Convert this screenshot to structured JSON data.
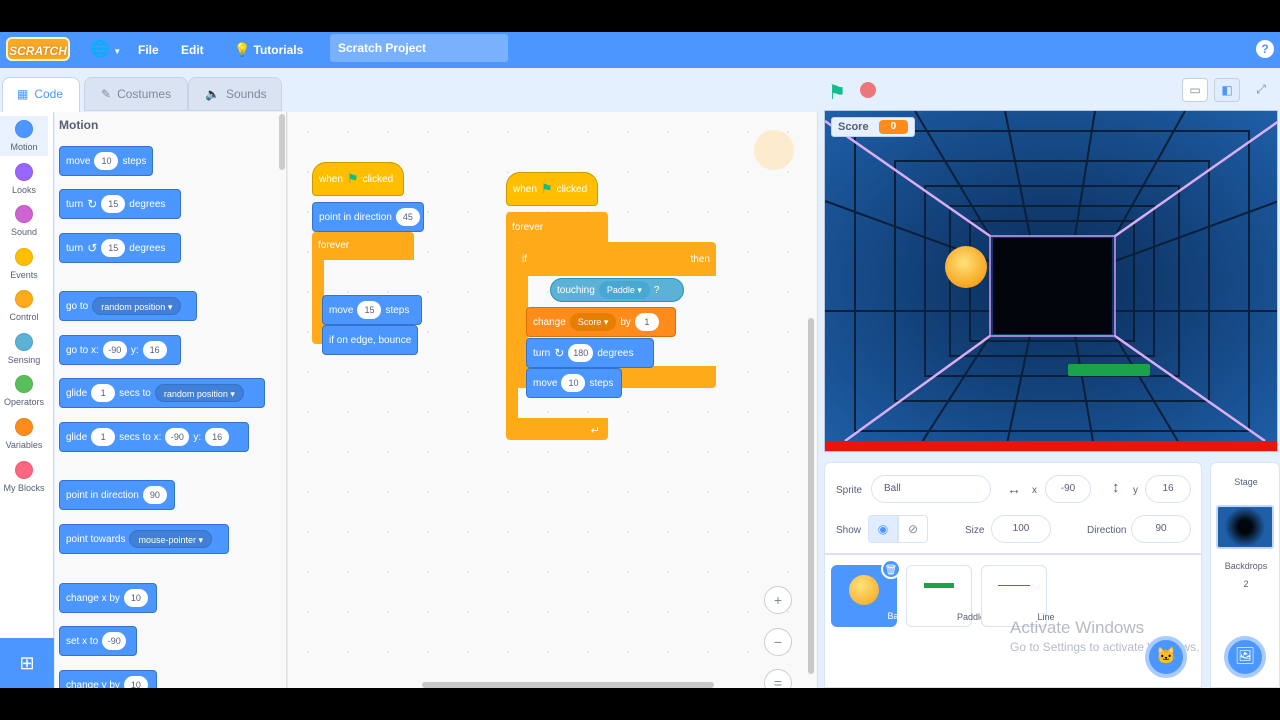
{
  "menubar": {
    "logo": "SCRATCH",
    "file": "File",
    "edit": "Edit",
    "tutorials": "Tutorials",
    "project_title": "Scratch Project",
    "help": "?"
  },
  "tabs": {
    "code": "Code",
    "costumes": "Costumes",
    "sounds": "Sounds"
  },
  "categories": [
    {
      "label": "Motion",
      "color": "#4c97ff"
    },
    {
      "label": "Looks",
      "color": "#9966ff"
    },
    {
      "label": "Sound",
      "color": "#cf63cf"
    },
    {
      "label": "Events",
      "color": "#ffbf00"
    },
    {
      "label": "Control",
      "color": "#ffab19"
    },
    {
      "label": "Sensing",
      "color": "#5cb1d6"
    },
    {
      "label": "Operators",
      "color": "#59c059"
    },
    {
      "label": "Variables",
      "color": "#ff8c1a"
    },
    {
      "label": "My Blocks",
      "color": "#ff6680"
    }
  ],
  "palette": {
    "title": "Motion",
    "move": {
      "a": "move",
      "n": "10",
      "b": "steps"
    },
    "turn_cw": {
      "a": "turn",
      "n": "15",
      "b": "degrees"
    },
    "turn_ccw": {
      "a": "turn",
      "n": "15",
      "b": "degrees"
    },
    "goto": {
      "a": "go to",
      "d": "random position"
    },
    "goto_xy": {
      "a": "go to x:",
      "x": "-90",
      "yl": "y:",
      "y": "16"
    },
    "glide": {
      "a": "glide",
      "n": "1",
      "b": "secs to",
      "d": "random position"
    },
    "glide_xy": {
      "a": "glide",
      "n": "1",
      "b": "secs to x:",
      "x": "-90",
      "yl": "y:",
      "y": "16"
    },
    "point_dir": {
      "a": "point in direction",
      "n": "90"
    },
    "point_towards": {
      "a": "point towards",
      "d": "mouse-pointer"
    },
    "change_x": {
      "a": "change x by",
      "n": "10"
    },
    "set_x": {
      "a": "set x to",
      "n": "-90"
    },
    "change_y": {
      "a": "change y by",
      "n": "10"
    }
  },
  "script1": {
    "hat": {
      "a": "when",
      "b": "clicked"
    },
    "point": {
      "a": "point in direction",
      "n": "45"
    },
    "forever": "forever",
    "move": {
      "a": "move",
      "n": "15",
      "b": "steps"
    },
    "bounce": "if on edge, bounce"
  },
  "script2": {
    "hat": {
      "a": "when",
      "b": "clicked"
    },
    "forever": "forever",
    "if": "if",
    "touching": {
      "a": "touching",
      "d": "Paddle",
      "q": "?"
    },
    "then": "then",
    "change": {
      "a": "change",
      "d": "Score",
      "b": "by",
      "n": "1"
    },
    "turn": {
      "a": "turn",
      "n": "180",
      "b": "degrees"
    },
    "move": {
      "a": "move",
      "n": "10",
      "b": "steps"
    }
  },
  "zoom": {
    "in": "+",
    "out": "−",
    "reset": "="
  },
  "stage": {
    "score_label": "Score",
    "score_value": "0"
  },
  "sprite_info": {
    "sprite_label": "Sprite",
    "sprite_name": "Ball",
    "x_label": "x",
    "x": "-90",
    "y_label": "y",
    "y": "16",
    "show_label": "Show",
    "size_label": "Size",
    "size": "100",
    "direction_label": "Direction",
    "direction": "90"
  },
  "sprites": [
    {
      "name": "Ball"
    },
    {
      "name": "Paddle"
    },
    {
      "name": "Line"
    }
  ],
  "stage_pane": {
    "title": "Stage",
    "backdrops_label": "Backdrops",
    "backdrops_count": "2"
  },
  "watermark": {
    "line1": "Activate Windows",
    "line2": "Go to Settings to activate Windows."
  }
}
